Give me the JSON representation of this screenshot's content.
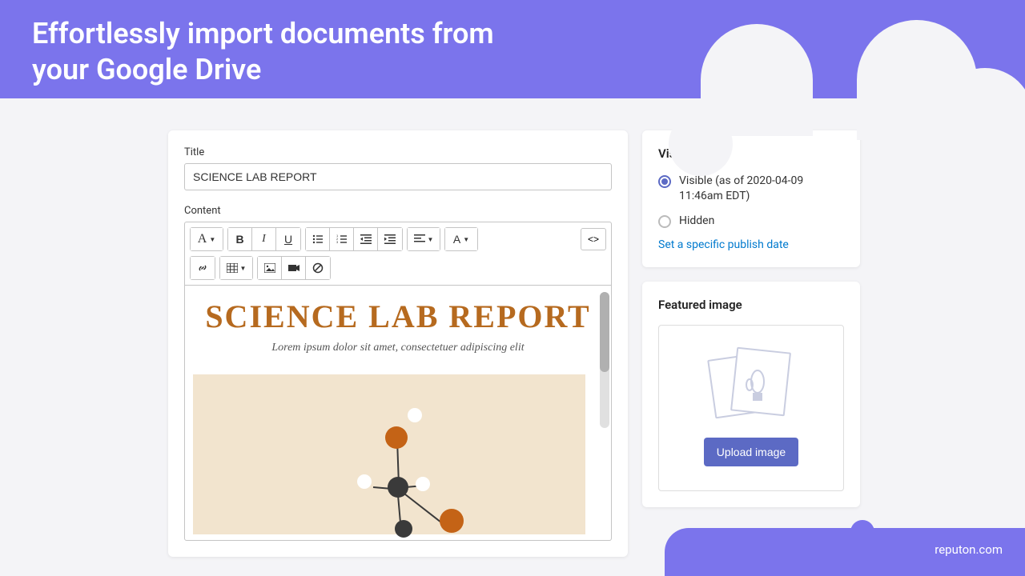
{
  "header": {
    "title": "Effortlessly import documents from your Google Drive"
  },
  "editor": {
    "title_label": "Title",
    "title_value": "SCIENCE LAB REPORT",
    "content_label": "Content",
    "doc_title": "SCIENCE LAB REPORT",
    "doc_subtitle": "Lorem ipsum dolor sit amet, consectetuer adipiscing elit"
  },
  "visibility": {
    "heading": "Visibility",
    "visible_label": "Visible (as of 2020-04-09 11:46am EDT)",
    "hidden_label": "Hidden",
    "publish_link": "Set a specific publish date"
  },
  "featured": {
    "heading": "Featured image",
    "upload_button": "Upload image"
  },
  "footer": {
    "brand": "reputon.com"
  }
}
